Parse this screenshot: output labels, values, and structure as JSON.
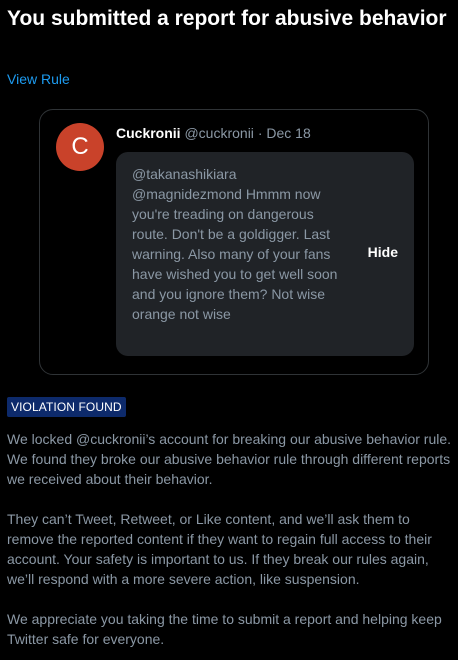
{
  "header": {
    "title": "You submitted a report for abusive behavior",
    "view_rule_link": "View Rule"
  },
  "tweet": {
    "avatar_letter": "C",
    "avatar_color": "#c9422a",
    "author_name": "Cuckronii",
    "author_handle": "@cuckronii",
    "separator": "·",
    "date": "Dec 18",
    "text": "@takanashikiara @magnidezmond Hmmm now you're treading on dangerous route. Don't be a goldigger. Last warning. Also many of your fans have wished you to get well soon and you ignore them? Not wise orange not wise",
    "hide_label": "Hide"
  },
  "violation": {
    "badge": "VIOLATION FOUND",
    "badge_color": "#0d2a6b"
  },
  "paragraphs": {
    "p1": "We locked @cuckronii’s account for breaking our abusive behavior rule. We found they broke our abusive behavior rule through different reports we received about their behavior.",
    "p2": "They can’t Tweet, Retweet, or Like content, and we’ll ask them to remove the reported content if they want to regain full access to their account. Your safety is important to us. If they break our rules again, we’ll respond with a more severe action, like suspension.",
    "p3": "We appreciate you taking the time to submit a report and helping keep Twitter safe for everyone."
  },
  "colors": {
    "link": "#1d9bf0",
    "muted_text": "#8b98a5",
    "background": "#000000"
  }
}
